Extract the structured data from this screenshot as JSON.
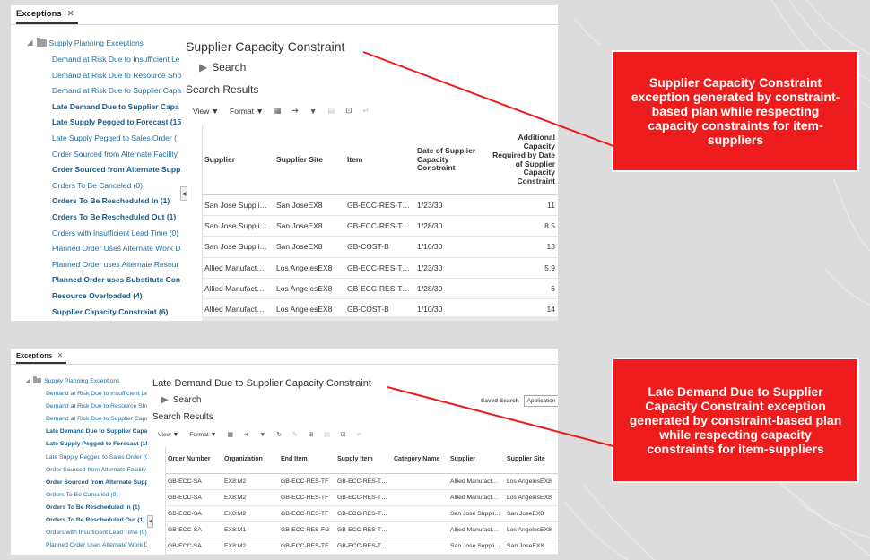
{
  "colors": {
    "callout": "#ee1c1c",
    "link": "#1f6f9a"
  },
  "shot1": {
    "tab_label": "Exceptions",
    "tree_root": "Supply Planning Exceptions",
    "tree_items": [
      {
        "label": "Demand at Risk Due to Insufficient Le",
        "bold": false
      },
      {
        "label": "Demand at Risk Due to Resource Sho",
        "bold": false
      },
      {
        "label": "Demand at Risk Due to Supplier Capa",
        "bold": false
      },
      {
        "label": "Late Demand Due to Supplier Capa",
        "bold": true
      },
      {
        "label": "Late Supply Pegged to Forecast (15",
        "bold": true
      },
      {
        "label": "Late Supply Pegged to Sales Order (",
        "bold": false
      },
      {
        "label": "Order Sourced from Alternate Facility",
        "bold": false
      },
      {
        "label": "Order Sourced from Alternate Supp",
        "bold": true
      },
      {
        "label": "Orders To Be Canceled (0)",
        "bold": false
      },
      {
        "label": "Orders To Be Rescheduled In (1)",
        "bold": true
      },
      {
        "label": "Orders To Be Rescheduled Out (1)",
        "bold": true
      },
      {
        "label": "Orders with Insufficient Lead Time (0)",
        "bold": false
      },
      {
        "label": "Planned Order Uses Alternate Work D",
        "bold": false
      },
      {
        "label": "Planned Order uses Alternate Resour",
        "bold": false
      },
      {
        "label": "Planned Order uses Substitute Con",
        "bold": true
      },
      {
        "label": "Resource Overloaded (4)",
        "bold": true
      },
      {
        "label": "Supplier Capacity Constraint (6)",
        "bold": true
      }
    ],
    "page_title": "Supplier Capacity Constraint",
    "search_label": "Search",
    "results_title": "Search Results",
    "toolbar": {
      "view": "View ▼",
      "format": "Format ▼"
    },
    "columns": [
      "Supplier",
      "Supplier Site",
      "Item",
      "Date of Supplier Capacity Constraint",
      "Additional Capacity Required by Date of Supplier Capacity Constraint"
    ],
    "rows": [
      [
        "San Jose Suppli…",
        "San JoseEX8",
        "GB-ECC-RES-T…",
        "1/23/30",
        "11"
      ],
      [
        "San Jose Suppli…",
        "San JoseEX8",
        "GB-ECC-RES-T…",
        "1/28/30",
        "8.5"
      ],
      [
        "San Jose Suppli…",
        "San JoseEX8",
        "GB-COST-B",
        "1/10/30",
        "13"
      ],
      [
        "Allied Manufact…",
        "Los AngelesEX8",
        "GB-ECC-RES-T…",
        "1/23/30",
        "5.9"
      ],
      [
        "Allied Manufact…",
        "Los AngelesEX8",
        "GB-ECC-RES-T…",
        "1/28/30",
        "6"
      ],
      [
        "Allied Manufact…",
        "Los AngelesEX8",
        "GB-COST-B",
        "1/10/30",
        "14"
      ]
    ]
  },
  "shot2": {
    "tab_label": "Exceptions",
    "tree_root": "Supply Planning Exceptions",
    "tree_items": [
      {
        "label": "Demand at Risk Due to Insufficient Le",
        "bold": false
      },
      {
        "label": "Demand at Risk Due to Resource Sho",
        "bold": false
      },
      {
        "label": "Demand at Risk Due to Supplier Capa",
        "bold": false
      },
      {
        "label": "Late Demand Due to Supplier Capa",
        "bold": true
      },
      {
        "label": "Late Supply Pegged to Forecast (15",
        "bold": true
      },
      {
        "label": "Late Supply Pegged to Sales Order (0",
        "bold": false
      },
      {
        "label": "Order Sourced from Alternate Facility",
        "bold": false
      },
      {
        "label": "Order Sourced from Alternate Supp",
        "bold": true
      },
      {
        "label": "Orders To Be Canceled (0)",
        "bold": false
      },
      {
        "label": "Orders To Be Rescheduled In (1)",
        "bold": true
      },
      {
        "label": "Orders To Be Rescheduled Out (1)",
        "bold": true
      },
      {
        "label": "Orders with Insufficient Lead Time (0)",
        "bold": false
      },
      {
        "label": "Planned Order Uses Alternate Work D",
        "bold": false
      }
    ],
    "page_title": "Late Demand Due to Supplier Capacity Constraint",
    "search_label": "Search",
    "saved_search_label": "Saved Search",
    "saved_search_value": "Application",
    "results_title": "Search Results",
    "toolbar": {
      "view": "View ▼",
      "format": "Format ▼"
    },
    "columns": [
      "Order Number",
      "Organization",
      "End Item",
      "Supply Item",
      "Category Name",
      "Supplier",
      "Supplier Site"
    ],
    "rows": [
      [
        "GB-ECC-SA",
        "EX8:M2",
        "GB-ECC-RES-TF",
        "GB-ECC-RES-T…",
        "",
        "Allied Manufact…",
        "Los AngelesEX8"
      ],
      [
        "GB-ECC-SA",
        "EX8:M2",
        "GB-ECC-RES-TF",
        "GB-ECC-RES-T…",
        "",
        "Allied Manufact…",
        "Los AngelesEX8"
      ],
      [
        "GB-ECC-SA",
        "EX8:M2",
        "GB-ECC-RES-TF",
        "GB-ECC-RES-T…",
        "",
        "San Jose Suppli…",
        "San JoseEX8"
      ],
      [
        "GB-ECC-SA",
        "EX8:M1",
        "GB-ECC-RES-FG",
        "GB-ECC-RES-T…",
        "",
        "Allied Manufact…",
        "Los AngelesEX8"
      ],
      [
        "GB-ECC-SA",
        "EX8:M2",
        "GB-ECC-RES-TF",
        "GB-ECC-RES-T…",
        "",
        "San Jose Suppli…",
        "San JoseEX8"
      ]
    ]
  },
  "callouts": [
    "Supplier Capacity Constraint exception generated by constraint-based plan while respecting capacity constraints for  item-suppliers",
    "Late Demand Due to Supplier Capacity Constraint exception generated by constraint-based plan while respecting capacity constraints for item-suppliers"
  ]
}
